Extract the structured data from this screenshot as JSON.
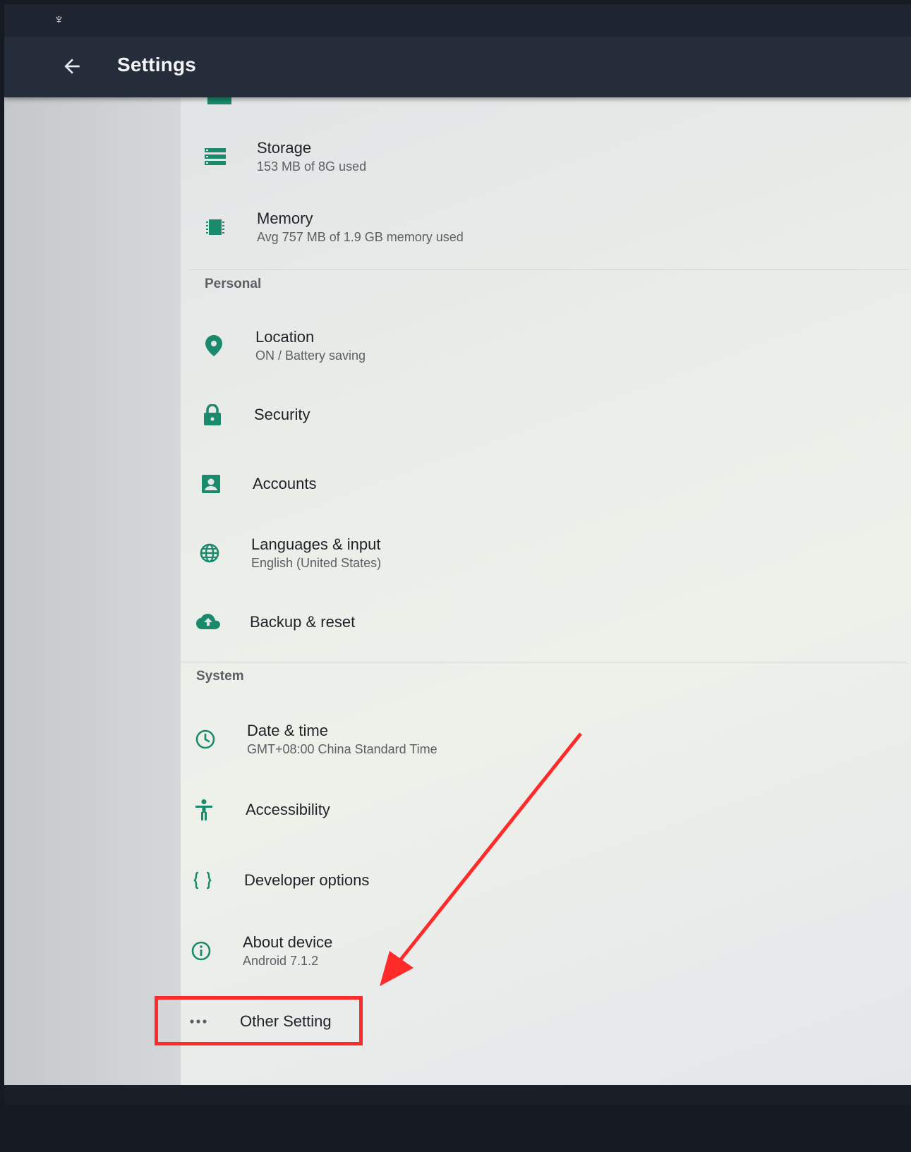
{
  "app_bar": {
    "title": "Settings"
  },
  "sections": {
    "personal_header": "Personal",
    "system_header": "System"
  },
  "items": {
    "storage": {
      "title": "Storage",
      "summary": "153 MB of 8G used",
      "icon": "storage-icon"
    },
    "memory": {
      "title": "Memory",
      "summary": "Avg 757 MB of 1.9 GB memory used",
      "icon": "memory-icon"
    },
    "location": {
      "title": "Location",
      "summary": "ON / Battery saving",
      "icon": "location-pin-icon"
    },
    "security": {
      "title": "Security",
      "icon": "lock-icon"
    },
    "accounts": {
      "title": "Accounts",
      "icon": "account-icon"
    },
    "languages": {
      "title": "Languages & input",
      "summary": "English (United States)",
      "icon": "globe-icon"
    },
    "backup": {
      "title": "Backup & reset",
      "icon": "cloud-upload-icon"
    },
    "datetime": {
      "title": "Date & time",
      "summary": "GMT+08:00 China Standard Time",
      "icon": "clock-icon"
    },
    "accessibility": {
      "title": "Accessibility",
      "icon": "accessibility-icon"
    },
    "developer": {
      "title": "Developer options",
      "icon": "code-braces-icon"
    },
    "about": {
      "title": "About device",
      "summary": "Android 7.1.2",
      "icon": "info-icon"
    },
    "other": {
      "title": "Other Setting",
      "icon": "more-horiz-icon"
    }
  },
  "colors": {
    "accent": "#1b8a6c",
    "app_bar": "#252c3a",
    "annotation": "#ff2a2a"
  }
}
